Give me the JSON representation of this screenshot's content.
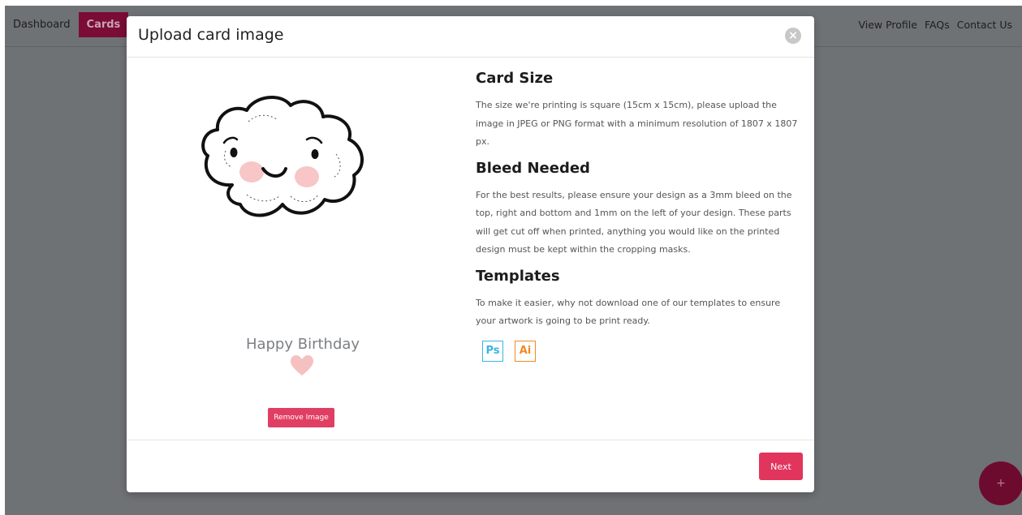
{
  "nav": {
    "left": [
      "Dashboard",
      "Cards"
    ],
    "right": [
      "View Profile",
      "FAQs",
      "Contact Us"
    ],
    "active_index": 1
  },
  "fab": {
    "label": "+"
  },
  "modal": {
    "title": "Upload card image",
    "close_icon": "×",
    "preview": {
      "greeting": "Happy Birthday",
      "remove_label": "Remove Image"
    },
    "sections": [
      {
        "title": "Card Size",
        "text": "The size we're printing is square (15cm x 15cm), please upload the image in JPEG or PNG format with a minimum resolution of 1807 x 1807 px."
      },
      {
        "title": "Bleed Needed",
        "text": "For the best results, please ensure your design as a 3mm bleed on the top, right and bottom and 1mm on the left of your design. These parts will get cut off when printed, anything you would like on the printed design must be kept within the cropping masks."
      },
      {
        "title": "Templates",
        "text": "To make it easier, why not download one of our templates to ensure your artwork is going to be print ready."
      }
    ],
    "templates": [
      {
        "label": "Ps",
        "icon": "photoshop-icon",
        "color": "#3ab4e6"
      },
      {
        "label": "Ai",
        "icon": "illustrator-icon",
        "color": "#ef8a24"
      }
    ],
    "next_label": "Next"
  },
  "colors": {
    "accent": "#e1355e",
    "nav_active": "#7a0c35"
  }
}
